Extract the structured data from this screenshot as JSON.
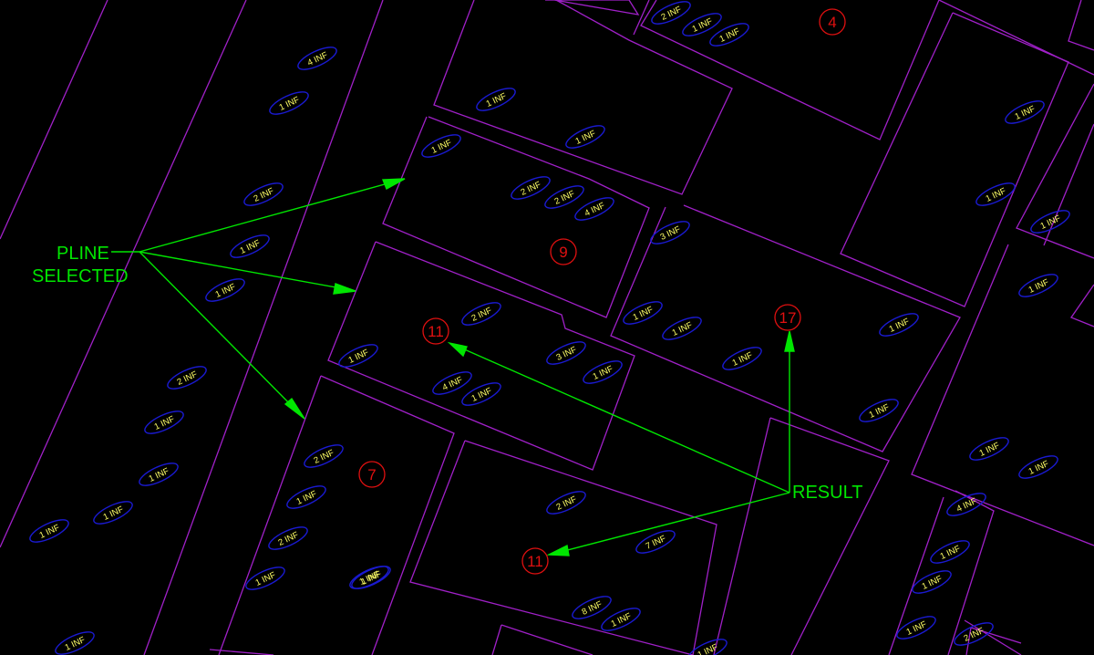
{
  "colors": {
    "background": "#000000",
    "parcel_line": "#a020c8",
    "tag_ellipse": "#1a1ad0",
    "tag_text": "#ffff66",
    "count_circle": "#e01010",
    "callout": "#00e600"
  },
  "callouts": {
    "pline_line1": "PLINE",
    "pline_line2": "SELECTED",
    "result": "RESULT"
  },
  "count_labels": [
    "4",
    "9",
    "11",
    "17",
    "7",
    "11"
  ],
  "tags": [
    "4 INF",
    "1 INF",
    "1 INF",
    "2 INF",
    "1 INF",
    "1 INF",
    "1 INF",
    "1 INF",
    "1 INF",
    "2 INF",
    "2 INF",
    "4 INF",
    "1 INF",
    "1 INF",
    "1 INF",
    "3 INF",
    "1 INF",
    "2 INF",
    "2 INF",
    "1 INF",
    "1 INF",
    "1 INF",
    "3 INF",
    "1 INF",
    "1 INF",
    "4 INF",
    "1 INF",
    "2 INF",
    "1 INF",
    "1 INF",
    "1 INF",
    "2 INF",
    "1 INF",
    "1 INF",
    "2 INF",
    "1 INF",
    "1 INF",
    "1 INF",
    "7 INF",
    "2 INF",
    "1 INF",
    "8 INF",
    "1 INF",
    "1 INF",
    "1 INF",
    "4 INF",
    "1 INF",
    "1 INF",
    "1 INF",
    "2 INF",
    "1 INF",
    "1 INF",
    "1 INF",
    "1 INF"
  ]
}
